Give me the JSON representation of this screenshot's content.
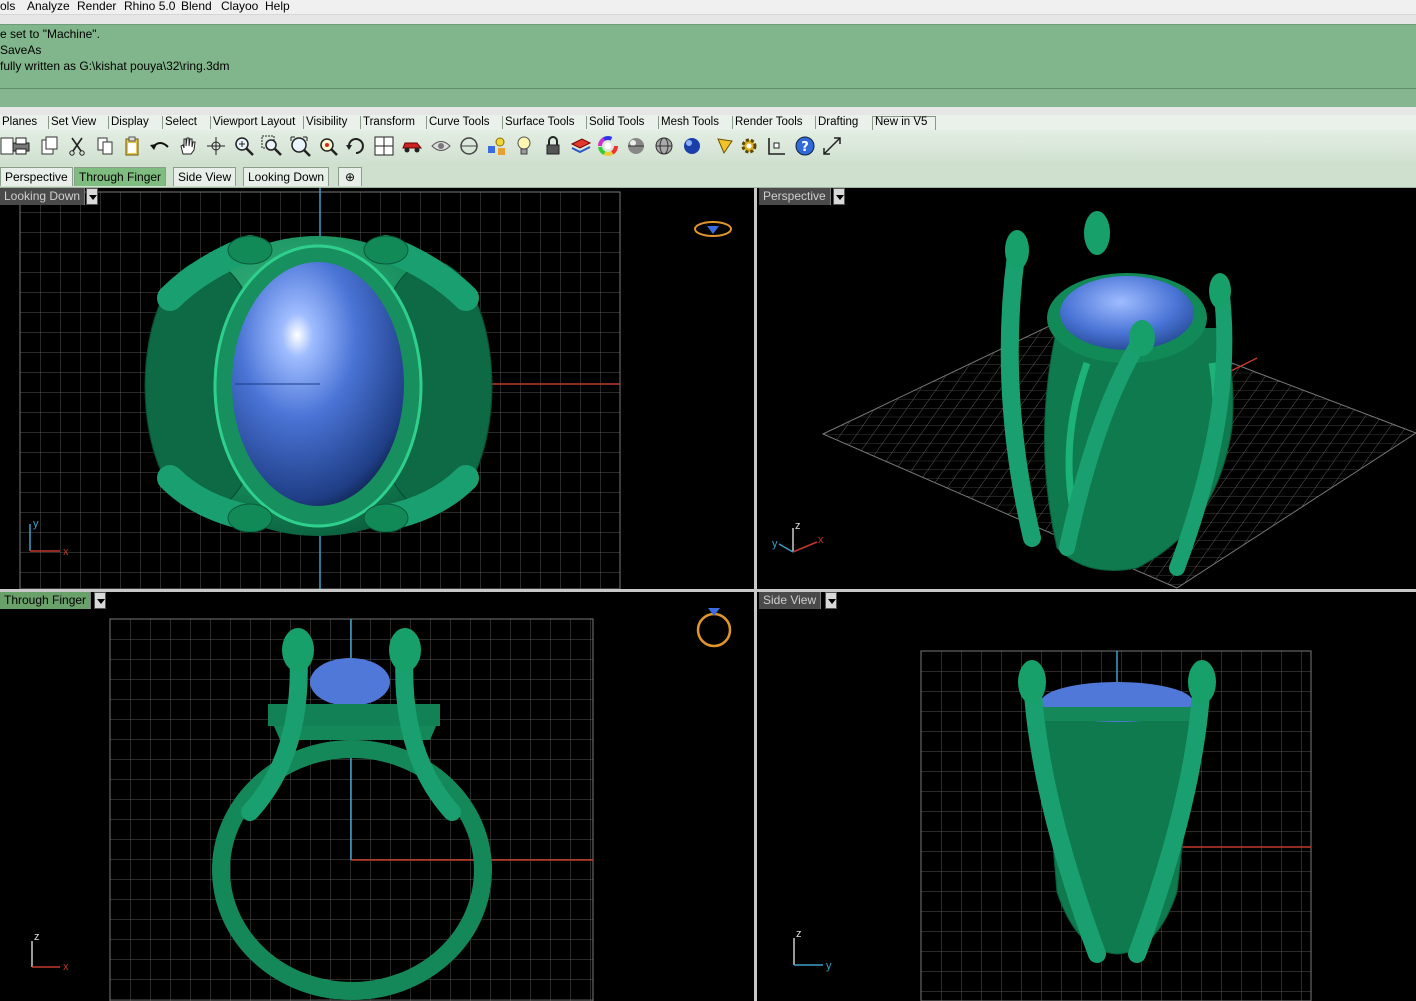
{
  "menu": [
    "ols",
    "Analyze",
    "Render",
    "Rhino 5.0",
    "Blend",
    "Clayoo",
    "Help"
  ],
  "history": [
    "e set to \"Machine\".",
    "SaveAs",
    "fully written as G:\\kishat pouya\\32\\ring.3dm"
  ],
  "toolbar_tabs": [
    "Planes",
    "Set View",
    "Display",
    "Select",
    "Viewport Layout",
    "Visibility",
    "Transform",
    "Curve Tools",
    "Surface Tools",
    "Solid Tools",
    "Mesh Tools",
    "Render Tools",
    "Drafting",
    "New in V5"
  ],
  "icons": [
    "new-file-icon",
    "print-icon",
    "copy-file-icon",
    "cut-icon",
    "copy-icon",
    "paste-icon",
    "undo-icon",
    "pan-hand-icon",
    "move-view-icon",
    "zoom-in-icon",
    "zoom-window-icon",
    "zoom-extents-icon",
    "zoom-selected-icon",
    "rotate-view-icon",
    "four-viewports-icon",
    "car-icon",
    "hide-icon",
    "show-icon",
    "bulb-icon",
    "light-icon",
    "lock-icon",
    "layer-icon",
    "color-wheel-icon",
    "gray-sphere-icon",
    "mesh-sphere-icon",
    "blue-sphere-icon",
    "pencil-icon",
    "settings-icon",
    "osnap-icon",
    "help-icon",
    "expand-icon"
  ],
  "view_tabs": [
    {
      "label": "Perspective",
      "active": false
    },
    {
      "label": "Through Finger",
      "active": true
    },
    {
      "label": "Side View",
      "active": false
    },
    {
      "label": "Looking Down",
      "active": false
    }
  ],
  "viewports": {
    "top_left": {
      "label": "Looking Down",
      "axis_a": "y",
      "axis_b": "x"
    },
    "top_right": {
      "label": "Perspective",
      "axis_a": "z",
      "axis_b": "x",
      "axis_c": "y"
    },
    "bottom_left": {
      "label": "Through Finger",
      "axis_a": "z",
      "axis_b": "x"
    },
    "bottom_right": {
      "label": "Side View",
      "axis_a": "z",
      "axis_b": "y"
    }
  },
  "colors": {
    "history_bg": "#81b58c",
    "ring_green": "#1c8a5e",
    "stone_blue": "#4f78d8",
    "x_axis": "#c03a2a",
    "y_axis": "#3aa0c8"
  }
}
